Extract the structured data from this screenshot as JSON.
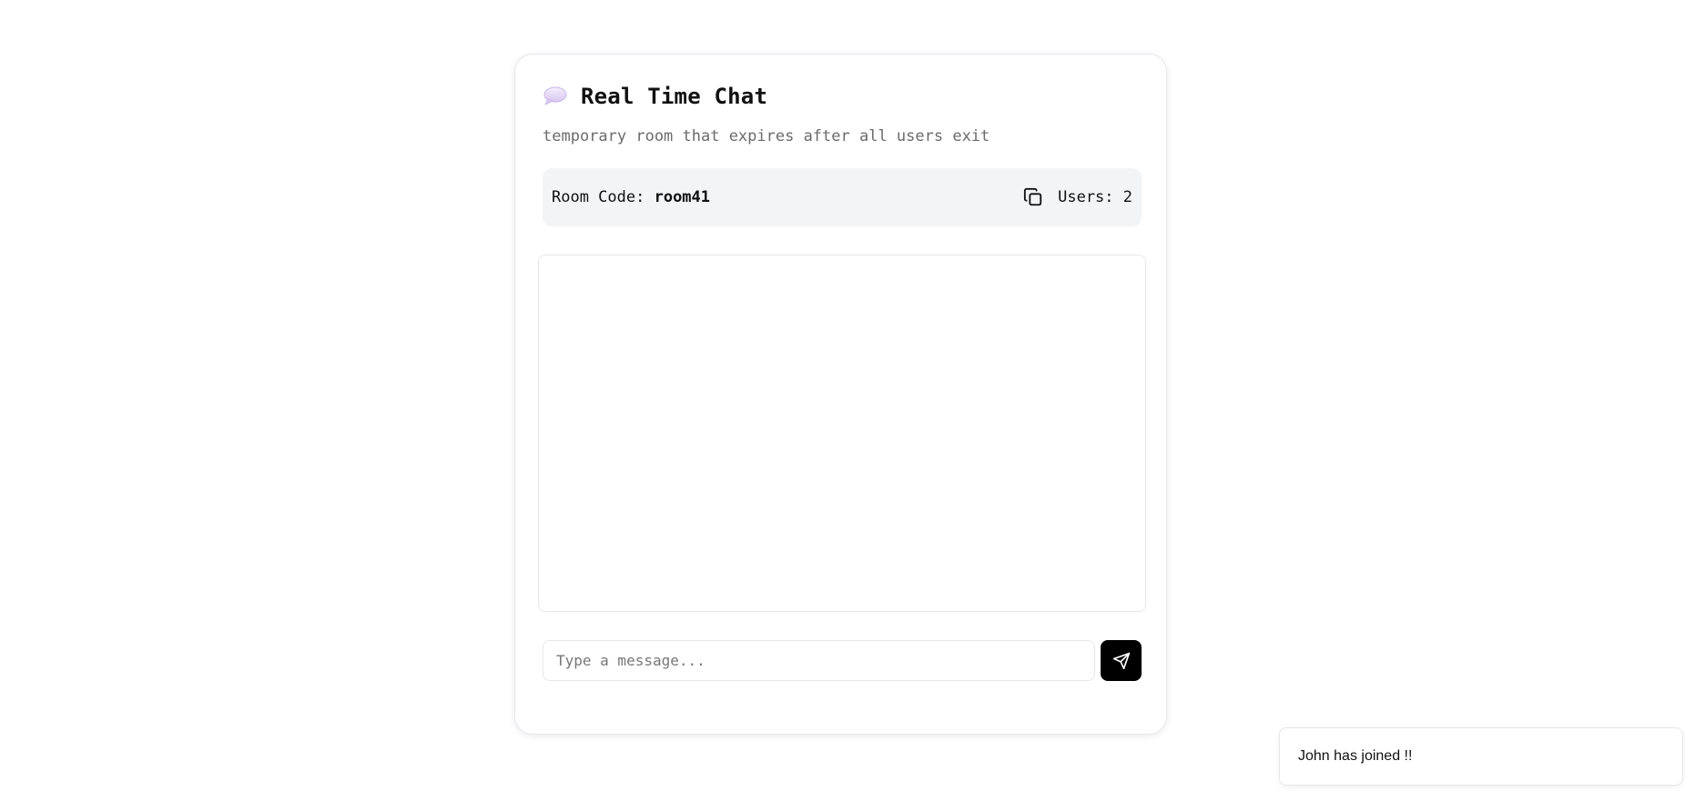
{
  "header": {
    "icon": "speech-bubble-icon",
    "title": "Real Time Chat",
    "subtitle": "temporary room that expires after all users exit"
  },
  "room": {
    "code_label": "Room Code: ",
    "code_value": "room41",
    "copy_icon": "copy-icon",
    "users_text": "Users: 2"
  },
  "composer": {
    "placeholder": "Type a message...",
    "value": "",
    "send_icon": "send-icon"
  },
  "messages": [],
  "toast": {
    "text": "John has joined !!"
  }
}
